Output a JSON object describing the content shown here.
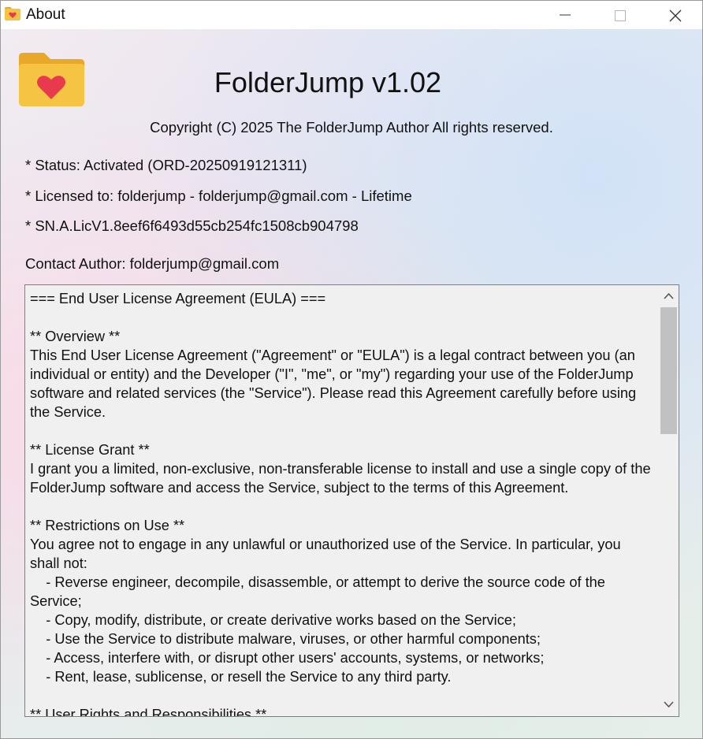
{
  "window": {
    "title": "About",
    "icon": "folder-heart-icon",
    "controls": [
      "minimize-icon",
      "maximize-icon",
      "close-icon"
    ]
  },
  "header": {
    "logo_icon": "folder-heart-icon",
    "app_title": "FolderJump v1.02",
    "copyright": "Copyright (C) 2025 The FolderJump Author All rights reserved."
  },
  "info": {
    "status": "* Status: Activated (ORD-20250919121311)",
    "licensed_to": "* Licensed to: folderjump - folderjump@gmail.com - Lifetime",
    "serial": "* SN.A.LicV1.8eef6f6493d55cb254fc1508cb904798",
    "contact": "Contact Author: folderjump@gmail.com"
  },
  "eula": {
    "text": "=== End User License Agreement (EULA) ===\n\n** Overview **\nThis End User License Agreement (\"Agreement\" or \"EULA\") is a legal contract between you (an individual or entity) and the Developer (\"I\", \"me\", or \"my\") regarding your use of the FolderJump software and related services (the \"Service\"). Please read this Agreement carefully before using the Service.\n\n** License Grant **\nI grant you a limited, non-exclusive, non-transferable license to install and use a single copy of the FolderJump software and access the Service, subject to the terms of this Agreement.\n\n** Restrictions on Use **\nYou agree not to engage in any unlawful or unauthorized use of the Service. In particular, you shall not:\n    - Reverse engineer, decompile, disassemble, or attempt to derive the source code of the Service;\n    - Copy, modify, distribute, or create derivative works based on the Service;\n    - Use the Service to distribute malware, viruses, or other harmful components;\n    - Access, interfere with, or disrupt other users' accounts, systems, or networks;\n    - Rent, lease, sublicense, or resell the Service to any third party.\n\n** User Rights and Responsibilities **"
  },
  "colors": {
    "folder": "#f6c443",
    "folder_tab": "#e8a92a",
    "heart": "#e8394d",
    "focus_border": "#3f8fd6"
  }
}
